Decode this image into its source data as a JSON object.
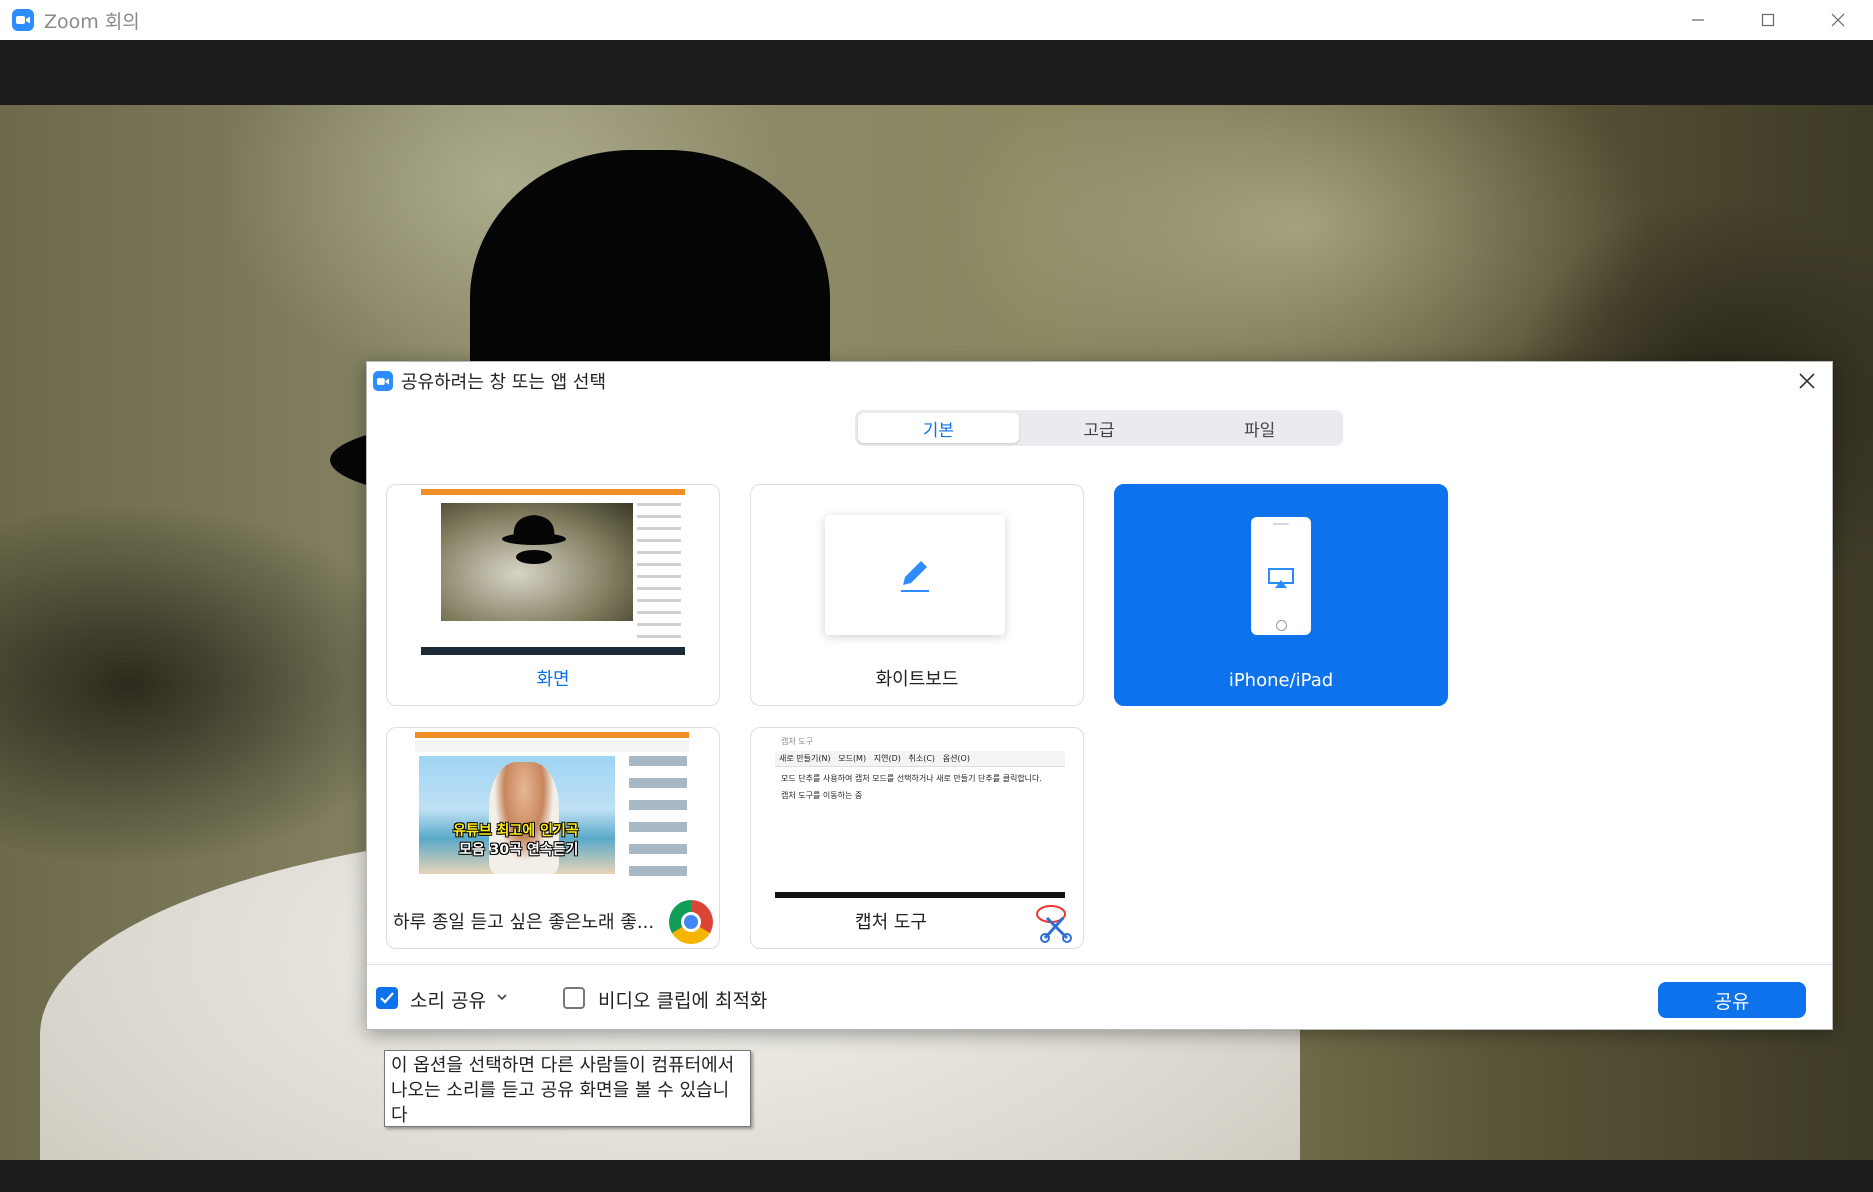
{
  "window": {
    "title": "Zoom 회의",
    "controls": [
      "minimize-icon",
      "maximize-icon",
      "close-icon"
    ]
  },
  "dialog": {
    "title": "공유하려는 창 또는 앱 선택",
    "tabs": [
      {
        "label": "기본",
        "active": true
      },
      {
        "label": "고급",
        "active": false
      },
      {
        "label": "파일",
        "active": false
      }
    ],
    "cards": [
      {
        "label": "화면",
        "type": "screen",
        "highlight_label": true
      },
      {
        "label": "화이트보드",
        "type": "whiteboard"
      },
      {
        "label": "iPhone/iPad",
        "type": "iphone",
        "selected": true
      },
      {
        "label": "하루 종일 듣고 싶은 좋은노래 좋...",
        "type": "app-window",
        "app_icon": "chrome-icon",
        "thumbnail_text": [
          "유튜브 최고에 인기곡",
          "모음 30곡 연속듣기"
        ]
      },
      {
        "label": "캡처 도구",
        "type": "app-window",
        "app_icon": "snipping-tool-icon",
        "thumbnail": {
          "title": "캡처 도구",
          "toolbar": [
            "새로 만들기(N)",
            "모드(M)",
            "지연(D)",
            "취소(C)",
            "옵션(O)"
          ],
          "message": "모드 단추를 사용하여 캡처 모드를 선택하거나 새로 만들기 단추를 클릭합니다.",
          "message2": "캡처 도구를 이동하는 중"
        }
      }
    ],
    "footer": {
      "share_sound": {
        "label": "소리 공유",
        "checked": true
      },
      "optimize_video": {
        "label": "비디오 클립에 최적화",
        "checked": false
      },
      "share_button": "공유"
    }
  },
  "tooltip": {
    "text": "이 옵션을 선택하면 다른 사람들이 컴퓨터에서 나오는 소리를 듣고 공유 화면을 볼 수 있습니다"
  },
  "colors": {
    "accent": "#0e72ed",
    "zoom_blue": "#2d8cff"
  }
}
